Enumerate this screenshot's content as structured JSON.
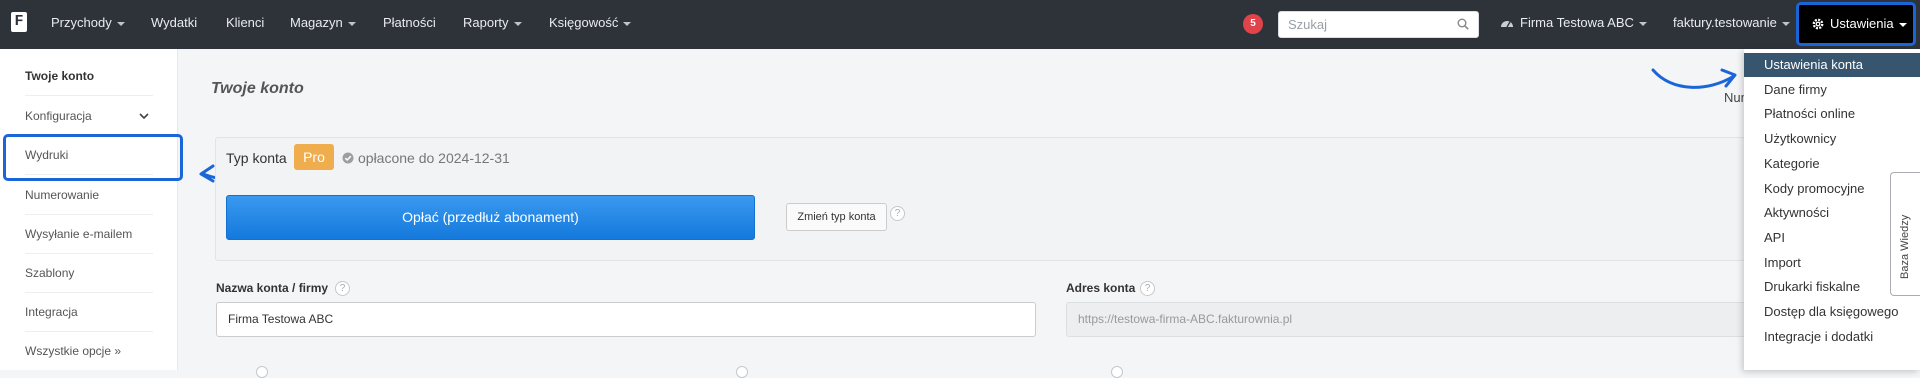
{
  "topbar": {
    "logo": "F",
    "nav": [
      {
        "label": "Przychody",
        "caret": true
      },
      {
        "label": "Wydatki",
        "caret": false
      },
      {
        "label": "Klienci",
        "caret": false
      },
      {
        "label": "Magazyn",
        "caret": true
      },
      {
        "label": "Płatności",
        "caret": false
      },
      {
        "label": "Raporty",
        "caret": true
      },
      {
        "label": "Księgowość",
        "caret": true
      }
    ],
    "notification_count": "5",
    "search_placeholder": "Szukaj",
    "company": "Firma Testowa ABC",
    "user": "faktury.testowanie",
    "settings_label": "Ustawienia"
  },
  "sidebar": {
    "items": [
      {
        "label": "Twoje konto"
      },
      {
        "label": "Konfiguracja"
      },
      {
        "label": "Wydruki"
      },
      {
        "label": "Numerowanie"
      },
      {
        "label": "Wysyłanie e-mailem"
      },
      {
        "label": "Szablony"
      },
      {
        "label": "Integracja"
      },
      {
        "label": "Wszystkie opcje »"
      }
    ]
  },
  "main": {
    "title": "Twoje konto",
    "cut_text": "Num",
    "account_type_label": "Typ konta",
    "plan_badge": "Pro",
    "paid_until": "opłacone do 2024-12-31",
    "pay_button": "Opłać (przedłuż abonament)",
    "change_button": "Zmień typ konta",
    "help_mark": "?",
    "name_label": "Nazwa konta / firmy",
    "name_value": "Firma Testowa ABC",
    "address_label": "Adres konta",
    "address_value": "https://testowa-firma-ABC.fakturownia.pl"
  },
  "dropdown": {
    "items": [
      {
        "label": "Ustawienia konta"
      },
      {
        "label": "Dane firmy"
      },
      {
        "label": "Płatności online"
      },
      {
        "label": "Użytkownicy"
      },
      {
        "label": "Kategorie"
      },
      {
        "label": "Kody promocyjne"
      },
      {
        "label": "Aktywności"
      },
      {
        "label": "API"
      },
      {
        "label": "Import"
      },
      {
        "label": "Drukarki fiskalne"
      },
      {
        "label": "Dostęp dla księgowego"
      },
      {
        "label": "Integracje i dodatki"
      }
    ],
    "selected": "Ustawienia konta"
  },
  "knowledge_base_tab": "Baza Wiedzy",
  "colors": {
    "topbar": "#2d3339",
    "highlight": "#1a66d9",
    "primary_button": "#1479dc",
    "pro_badge": "#f0ad4e",
    "dropdown_selected": "#37556f",
    "badge": "#e0434a"
  }
}
